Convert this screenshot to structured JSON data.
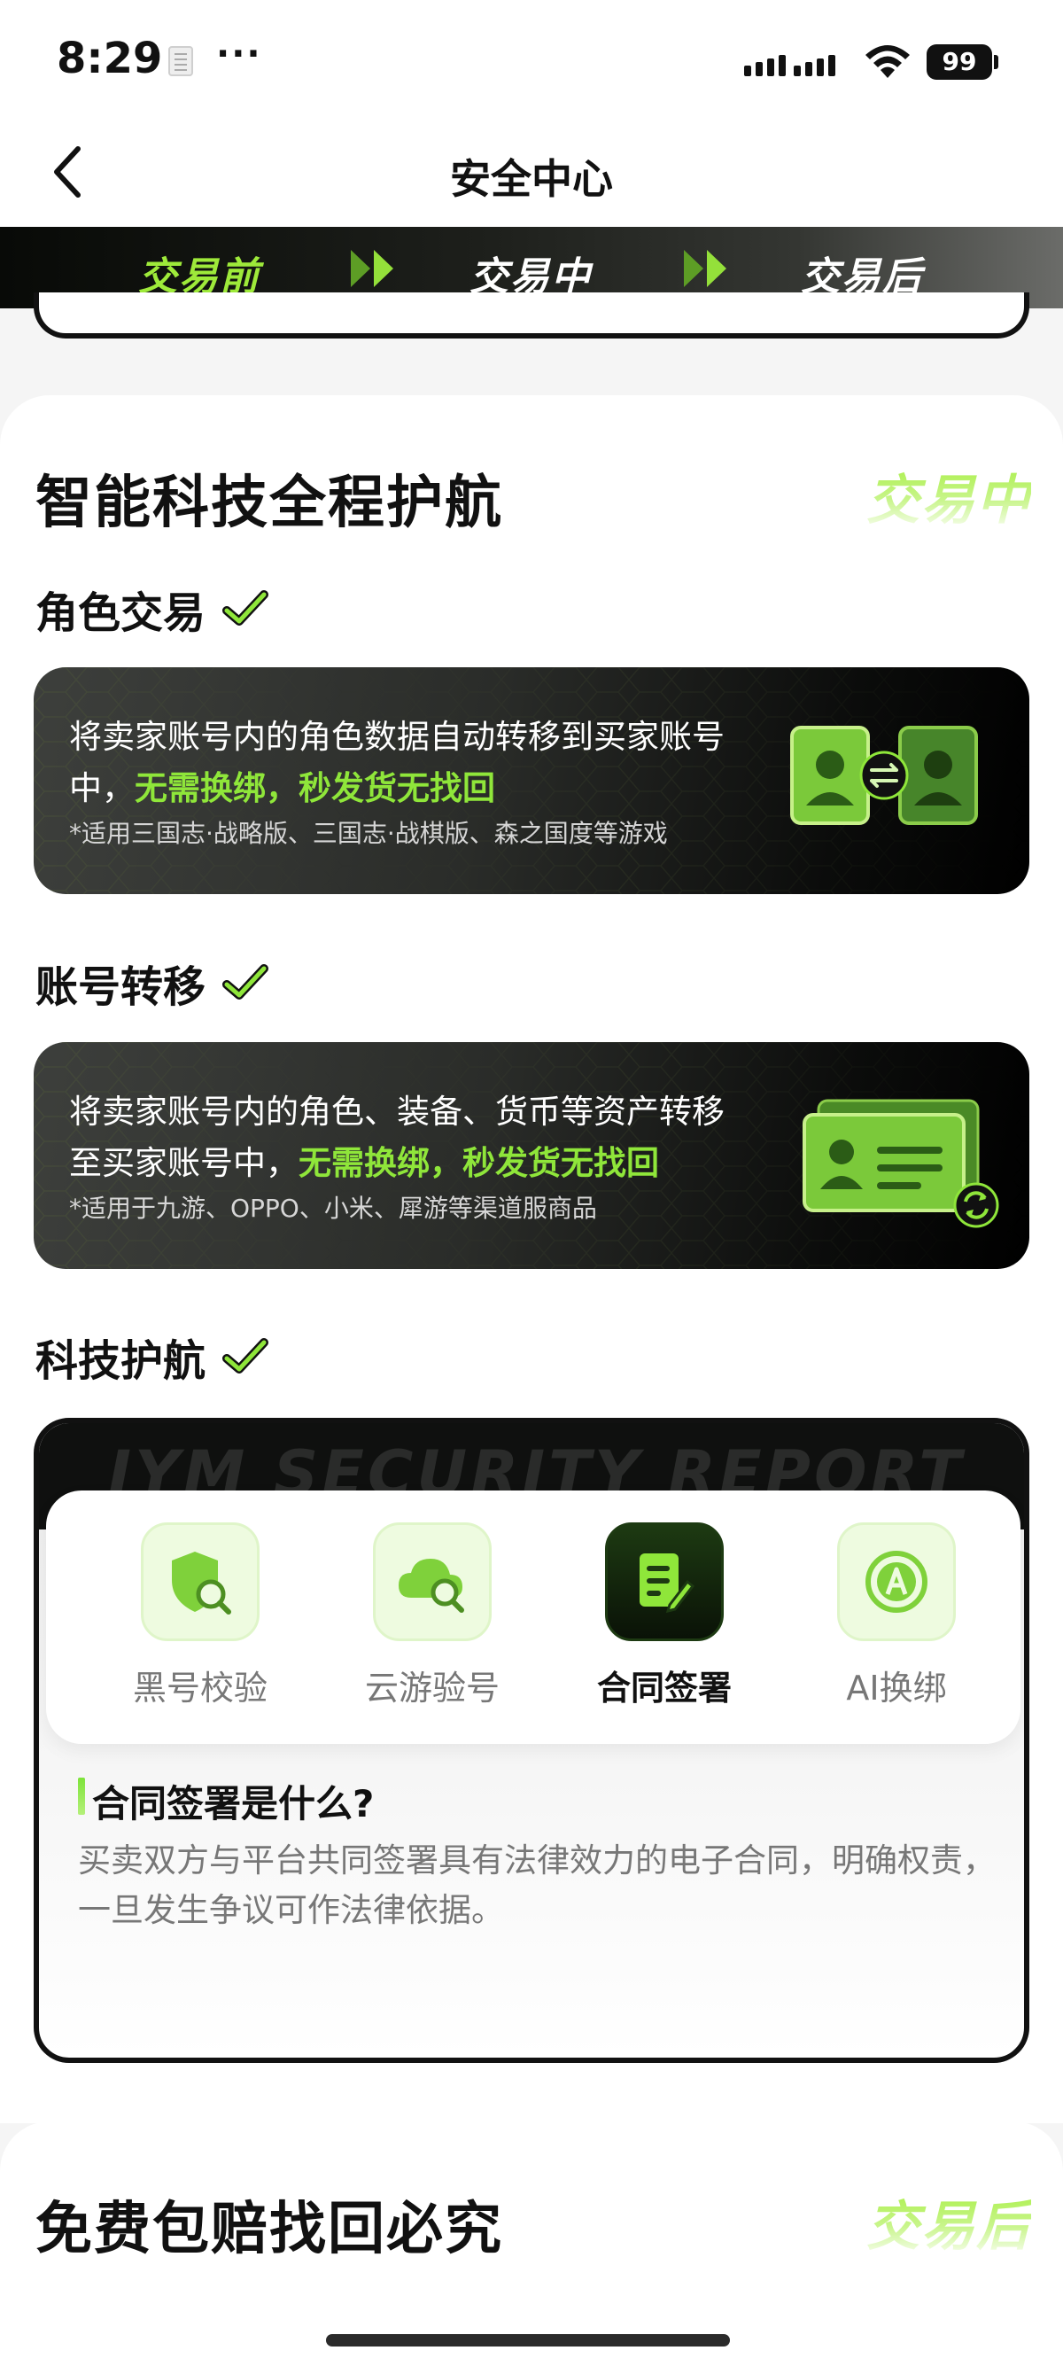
{
  "status_bar": {
    "time": "8:29",
    "dots": "···",
    "battery": "99"
  },
  "nav": {
    "title": "安全中心"
  },
  "steps": [
    {
      "label": "交易前"
    },
    {
      "label": "交易中"
    },
    {
      "label": "交易后"
    }
  ],
  "section_mid": {
    "title": "智能科技全程护航",
    "tag": "交易中",
    "role_trade": {
      "heading": "角色交易",
      "line1": "将卖家账号内的角色数据自动转移到买家账号",
      "line2_prefix": "中，",
      "line2_highlight": "无需换绑，秒发货无找回",
      "note": "*适用三国志·战略版、三国志·战棋版、森之国度等游戏"
    },
    "account_transfer": {
      "heading": "账号转移",
      "line1": "将卖家账号内的角色、装备、货币等资产转移",
      "line2_prefix": "至买家账号中，",
      "line2_highlight": "无需换绑，秒发货无找回",
      "note": "*适用于九游、OPPO、小米、犀游等渠道服商品"
    },
    "tech": {
      "heading": "科技护航",
      "watermark": "IYM SECURITY REPORT",
      "tools": [
        {
          "label": "黑号校验",
          "icon": "shield-search-icon"
        },
        {
          "label": "云游验号",
          "icon": "cloud-search-icon"
        },
        {
          "label": "合同签署",
          "icon": "contract-sign-icon"
        },
        {
          "label": "AI换绑",
          "icon": "ai-rebind-icon"
        }
      ],
      "qa_title": "合同签署是什么?",
      "qa_body": "买卖双方与平台共同签署具有法律效力的电子合同，明确权责，一旦发生争议可作法律依据。"
    }
  },
  "section_after": {
    "title": "免费包赔找回必究",
    "tag": "交易后"
  },
  "colors": {
    "accent": "#8fe63a",
    "dark": "#111111"
  }
}
